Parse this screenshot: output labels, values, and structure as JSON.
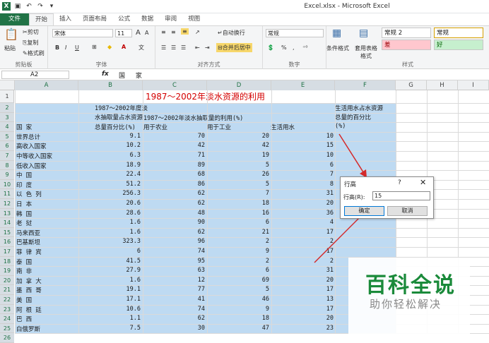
{
  "window": {
    "title": "Excel.xlsx - Microsoft Excel"
  },
  "tabs": [
    "文件",
    "开始",
    "插入",
    "页面布局",
    "公式",
    "数据",
    "审阅",
    "视图"
  ],
  "ribbon": {
    "clipboard": {
      "paste": "粘贴",
      "cut": "剪切",
      "copy": "复制",
      "format_painter": "格式刷",
      "label": "剪贴板"
    },
    "font": {
      "name": "宋体",
      "size": "11",
      "label": "字体",
      "bold": "B",
      "italic": "I",
      "underline": "U",
      "grow": "A",
      "shrink": "A"
    },
    "alignment": {
      "wrap": "自动换行",
      "merge": "合并后居中",
      "label": "对齐方式"
    },
    "number": {
      "format": "常规",
      "label": "数字",
      "pct": "%"
    },
    "styles": {
      "conditional": "条件格式",
      "table": "套用表格格式",
      "s1": "常规 2",
      "s2": "差",
      "s3": "常规",
      "s4": "好",
      "label": "样式"
    }
  },
  "formula_bar": {
    "cell_ref": "A2",
    "fx": "fx",
    "value": "国 家"
  },
  "columns": [
    "A",
    "B",
    "C",
    "D",
    "E",
    "F",
    "G",
    "H",
    "I"
  ],
  "rows": [
    "1",
    "2",
    "3",
    "4",
    "5",
    "6",
    "7",
    "8",
    "9",
    "10",
    "11",
    "12",
    "13",
    "14",
    "15",
    "16",
    "17",
    "18",
    "19",
    "20",
    "21",
    "22",
    "23",
    "24",
    "25",
    "26"
  ],
  "sheet": {
    "title": "1987～2002年淡水资源的利用",
    "header_a": "国    家",
    "header_b": [
      "1987～2002年度淡",
      "水抽取量占水资源",
      "总量百分比(%)"
    ],
    "header_cde": "1987～2002年淡水抽取量的利用(%)",
    "header_c": "用于农业",
    "header_d": "用于工业",
    "header_e": "生活用水",
    "header_f": [
      "生活用水占水资源",
      "总量的百分比",
      "(%)"
    ],
    "data": [
      [
        "世界总计",
        "9.1",
        "70",
        "20",
        "10"
      ],
      [
        "高收入国家",
        "10.2",
        "42",
        "42",
        "15"
      ],
      [
        "中等收入国家",
        "6.3",
        "71",
        "19",
        "10"
      ],
      [
        "低收入国家",
        "18.9",
        "89",
        "5",
        "6"
      ],
      [
        "中    国",
        "22.4",
        "68",
        "26",
        "7"
      ],
      [
        "印    度",
        "51.2",
        "86",
        "5",
        "8"
      ],
      [
        "以 色 列",
        "256.3",
        "62",
        "7",
        "31"
      ],
      [
        "日    本",
        "20.6",
        "62",
        "18",
        "20"
      ],
      [
        "韩    国",
        "28.6",
        "48",
        "16",
        "36"
      ],
      [
        "老    挝",
        "1.6",
        "90",
        "6",
        "4"
      ],
      [
        "马来西亚",
        "1.6",
        "62",
        "21",
        "17"
      ],
      [
        "巴基斯坦",
        "323.3",
        "96",
        "2",
        "2"
      ],
      [
        "菲 律 宾",
        "6",
        "74",
        "9",
        "17"
      ],
      [
        "泰    国",
        "41.5",
        "95",
        "2",
        "2"
      ],
      [
        "南    非",
        "27.9",
        "63",
        "6",
        "31"
      ],
      [
        "加 拿 大",
        "1.6",
        "12",
        "69",
        "20"
      ],
      [
        "墨 西 哥",
        "19.1",
        "77",
        "5",
        "17"
      ],
      [
        "美    国",
        "17.1",
        "41",
        "46",
        "13"
      ],
      [
        "阿 根 廷",
        "10.6",
        "74",
        "9",
        "17"
      ],
      [
        "巴    西",
        "1.1",
        "62",
        "18",
        "20"
      ],
      [
        "白俄罗斯",
        "7.5",
        "30",
        "47",
        "23"
      ]
    ]
  },
  "dialog": {
    "title": "行高",
    "help": "?",
    "close": "✕",
    "label": "行高(R):",
    "value": "15",
    "ok": "确定",
    "cancel": "取消"
  },
  "watermark": {
    "main": "百科全说",
    "sub": "助你轻松解决"
  },
  "colors": {
    "excel_green": "#217346",
    "selection": "#bedaf2",
    "title_red": "#d40000",
    "watermark_green": "#1a8a3a"
  }
}
